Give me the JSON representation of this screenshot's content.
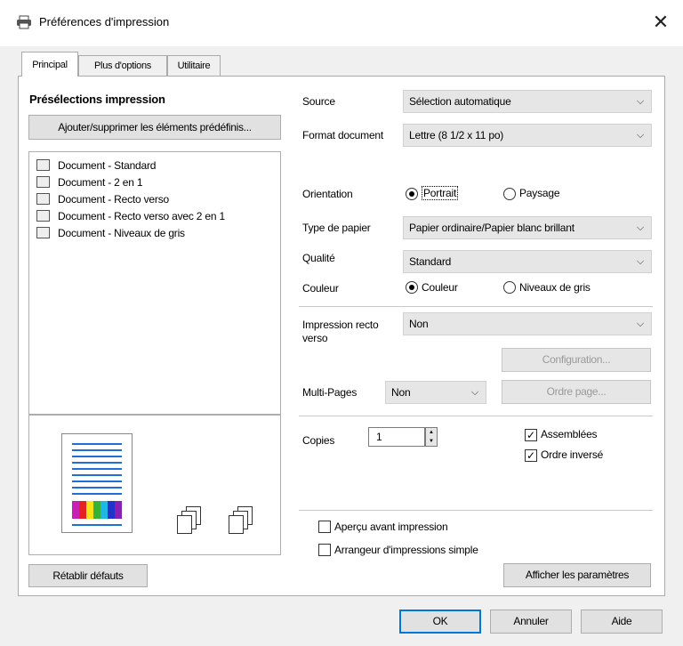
{
  "window": {
    "title": "Préférences d'impression",
    "close_glyph": "✕"
  },
  "tabs": [
    {
      "label": "Principal",
      "active": true
    },
    {
      "label": "Plus d'options",
      "active": false
    },
    {
      "label": "Utilitaire",
      "active": false
    }
  ],
  "presets": {
    "heading": "Présélections impression",
    "manage_button": "Ajouter/supprimer les éléments prédéfinis...",
    "items": [
      {
        "label": "Document - Standard",
        "icon": "document-icon"
      },
      {
        "label": "Document - 2 en 1",
        "icon": "two-in-one-icon"
      },
      {
        "label": "Document - Recto verso",
        "icon": "duplex-icon"
      },
      {
        "label": "Document - Recto verso avec 2 en 1",
        "icon": "duplex-two-in-one-icon"
      },
      {
        "label": "Document - Niveaux de gris",
        "icon": "grayscale-icon"
      }
    ]
  },
  "settings": {
    "source": {
      "label": "Source",
      "value": "Sélection automatique"
    },
    "format": {
      "label": "Format document",
      "value": "Lettre (8 1/2 x 11 po)"
    },
    "orientation": {
      "label": "Orientation",
      "option_portrait": "Portrait",
      "option_landscape": "Paysage",
      "selected": "Portrait"
    },
    "paper_type": {
      "label": "Type de papier",
      "value": "Papier ordinaire/Papier blanc brillant"
    },
    "quality": {
      "label": "Qualité",
      "value": "Standard"
    },
    "color": {
      "label": "Couleur",
      "option_color": "Couleur",
      "option_gray": "Niveaux de gris",
      "selected": "Couleur"
    },
    "duplex": {
      "label_line1": "Impression recto",
      "label_line2": "verso",
      "value": "Non"
    },
    "config_button": "Configuration...",
    "multipages": {
      "label": "Multi-Pages",
      "value": "Non"
    },
    "page_order_button": "Ordre page...",
    "copies": {
      "label": "Copies",
      "value": "1"
    },
    "collate": {
      "label": "Assemblées",
      "checked": true
    },
    "reverse": {
      "label": "Ordre inversé",
      "checked": true
    },
    "preview_check": {
      "label": "Aperçu avant impression",
      "checked": false
    },
    "arranger_check": {
      "label": "Arrangeur d'impressions simple",
      "checked": false
    },
    "show_settings_button": "Afficher les paramètres",
    "restore_button": "Rétablir défauts"
  },
  "footer": {
    "ok": "OK",
    "cancel": "Annuler",
    "help": "Aide"
  },
  "glyphs": {
    "chevron": "⌵",
    "check": "✓",
    "spin_up": "▲",
    "spin_down": "▼"
  },
  "colors": {
    "accent_blue": "#1f6fd6",
    "selection": "#0078d7"
  }
}
